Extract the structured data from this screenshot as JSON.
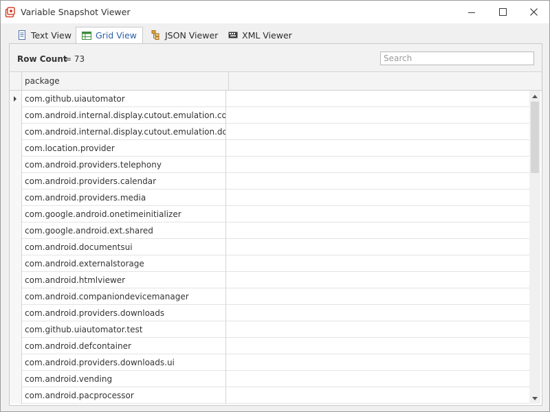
{
  "window": {
    "title": "Variable Snapshot Viewer"
  },
  "tabs": [
    {
      "label": "Text View",
      "icon": "text-document-icon",
      "active": false
    },
    {
      "label": "Grid View",
      "icon": "grid-icon",
      "active": true
    },
    {
      "label": "JSON Viewer",
      "icon": "json-tree-icon",
      "active": false
    },
    {
      "label": "XML Viewer",
      "icon": "xml-icon",
      "active": false
    }
  ],
  "toolbar": {
    "row_count_label": "Row Count",
    "row_count_value": "= 73",
    "search_placeholder": "Search"
  },
  "grid": {
    "columns": [
      "package",
      ""
    ],
    "rows": [
      "com.github.uiautomator",
      "com.android.internal.display.cutout.emulation.corner",
      "com.android.internal.display.cutout.emulation.double",
      "com.location.provider",
      "com.android.providers.telephony",
      "com.android.providers.calendar",
      "com.android.providers.media",
      "com.google.android.onetimeinitializer",
      "com.google.android.ext.shared",
      "com.android.documentsui",
      "com.android.externalstorage",
      "com.android.htmlviewer",
      "com.android.companiondevicemanager",
      "com.android.providers.downloads",
      "com.github.uiautomator.test",
      "com.android.defcontainer",
      "com.android.providers.downloads.ui",
      "com.android.vending",
      "com.android.pacprocessor"
    ],
    "selected_row": 0
  },
  "colors": {
    "accent": "#2a5ea8",
    "app_icon": "#d2452e"
  }
}
